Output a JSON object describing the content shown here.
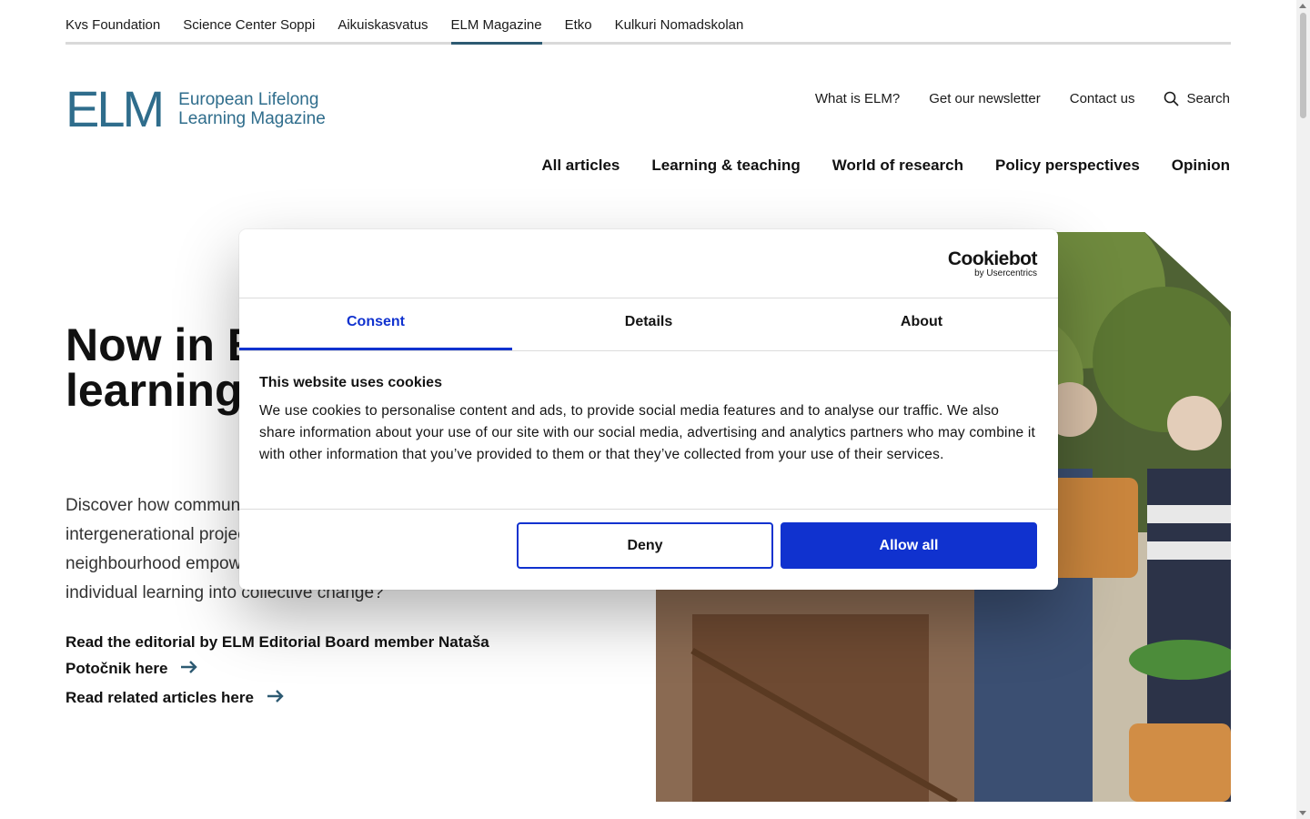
{
  "network_links": [
    {
      "label": "Kvs Foundation",
      "active": false
    },
    {
      "label": "Science Center Soppi",
      "active": false
    },
    {
      "label": "Aikuiskasvatus",
      "active": false
    },
    {
      "label": "ELM Magazine",
      "active": true
    },
    {
      "label": "Etko",
      "active": false
    },
    {
      "label": "Kulkuri Nomadskolan",
      "active": false
    }
  ],
  "logo": {
    "mark": "ELM",
    "line1": "European Lifelong",
    "line2": "Learning Magazine"
  },
  "secondary_nav": {
    "what_is": "What is ELM?",
    "newsletter": "Get our newsletter",
    "contact": "Contact us",
    "search": "Search"
  },
  "main_nav": [
    "All articles",
    "Learning & teaching",
    "World of research",
    "Policy perspectives",
    "Opinion"
  ],
  "hero": {
    "title": "Now in ELM: Community learning",
    "description": "Discover how community learning works in practice, from intergenerational projects and local cultural work to neighbourhood empowerment. What does it take to turn individual learning into collective change?",
    "link1": "Read the editorial by ELM Editorial Board member Nataša Potočnik here",
    "link2": "Read related articles here"
  },
  "cookie": {
    "brand": "Cookiebot",
    "brand_sub": "by Usercentrics",
    "tabs": [
      "Consent",
      "Details",
      "About"
    ],
    "active_tab": "Consent",
    "heading": "This website uses cookies",
    "body": "We use cookies to personalise content and ads, to provide social media features and to analyse our traffic. We also share information about your use of our site with our social media, advertising and analytics partners who may combine it with other information that you’ve provided to them or that they’ve collected from your use of their services.",
    "deny": "Deny",
    "allow": "Allow all"
  },
  "colors": {
    "brand": "#2f6d8c",
    "accent": "#1032cf",
    "active_underline": "#2d5a72"
  },
  "icons": {
    "search": "search-icon",
    "arrow": "arrow-right-icon"
  }
}
